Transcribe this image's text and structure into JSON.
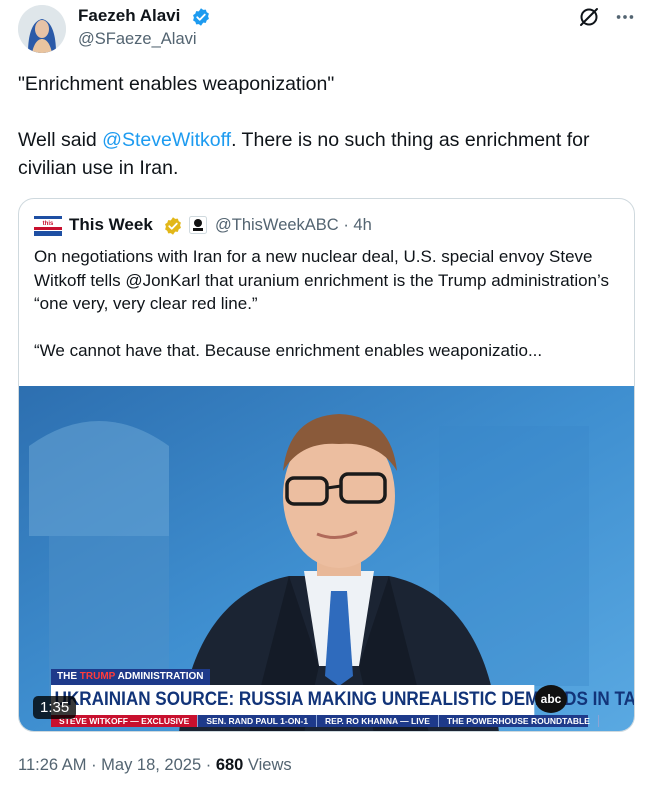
{
  "author": {
    "name": "Faezeh Alavi",
    "handle": "@SFaeze_Alavi"
  },
  "tweet": {
    "line1": "\"Enrichment enables weaponization\"",
    "line2_prefix": "Well said ",
    "mention": "@SteveWitkoff",
    "line2_suffix": ". There is no such thing as enrichment for civilian use in Iran."
  },
  "quote": {
    "name": "This Week",
    "handle": "@ThisWeekABC",
    "time": "· 4h",
    "text1": "On negotiations with Iran for a new nuclear deal, U.S. special envoy Steve Witkoff tells @JonKarl that uranium enrichment is the Trump administration’s “one very, very clear red line.”",
    "text2": "“We cannot have that. Because enrichment enables weaponizatio...",
    "video": {
      "pill_prefix": "THE",
      "pill_highlight": "TRUMP",
      "pill_suffix": "ADMINISTRATION",
      "headline": "UKRAINIAN SOURCE: RUSSIA MAKING UNREALISTIC DEMANDS IN TALKS",
      "network": "abc",
      "bottom": [
        "STEVE WITKOFF — EXCLUSIVE",
        "SEN. RAND PAUL 1-ON-1",
        "REP. RO KHANNA — LIVE",
        "THE POWERHOUSE ROUNDTABLE"
      ],
      "duration": "1:35"
    }
  },
  "meta": {
    "time": "11:26 AM · May 18, 2025 · ",
    "views_count": "680",
    "views_label": " Views"
  },
  "colors": {
    "link": "#1d9bf0",
    "verified_blue": "#1d9bf0",
    "verified_gold": "#e2b719",
    "secondary_text": "#536471"
  },
  "icons": {
    "verified": "verified-badge-icon",
    "grok": "grok-icon",
    "more": "more-horizontal-icon",
    "affiliate": "affiliate-badge-icon"
  }
}
